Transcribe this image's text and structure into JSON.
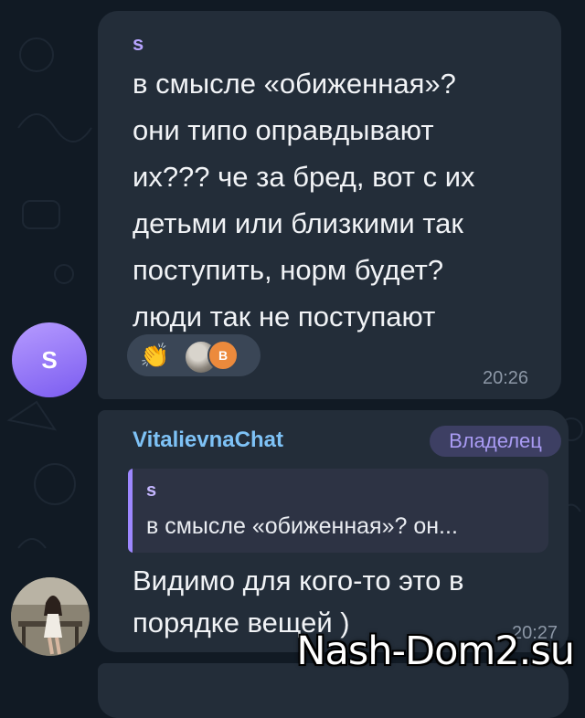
{
  "messages": [
    {
      "sender": "s",
      "avatar_letter": "S",
      "avatar_color": "#8f73f5",
      "text": "в смысле «обиженная»?\nони  типо оправдывают\nих??? че за бред, вот с их\nдетьми или близкими так\nпоступить, норм будет?\nлюди так не поступают",
      "reactions": {
        "emoji": "clapping-hands",
        "second_avatar_letter": "В"
      },
      "time": "20:26"
    },
    {
      "sender": "VitalievnaChat",
      "badge": "Владелец",
      "reply": {
        "sender": "s",
        "text": "в смысле «обиженная»? он..."
      },
      "text": "Видимо для кого-то это в\nпорядке вещей )",
      "time": "20:27"
    }
  ],
  "watermark": "Nash-Dom2.su",
  "colors": {
    "background": "#111a24",
    "bubble": "#232d39",
    "accent_name": "#7ec2f6",
    "reply_accent": "#9d87ff"
  }
}
